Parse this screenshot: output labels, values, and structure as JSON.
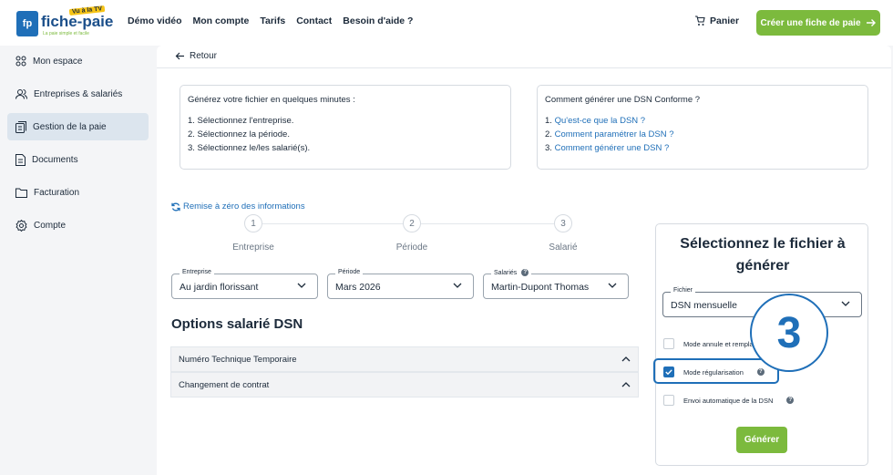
{
  "logo": {
    "initials": "fp",
    "brand": "fiche-paie",
    "badge": "Vu à la TV",
    "tagline": "La paie simple et facile"
  },
  "nav": [
    "Démo vidéo",
    "Mon compte",
    "Tarifs",
    "Contact",
    "Besoin d'aide ?"
  ],
  "cart_label": "Panier",
  "cta_label": "Créer une fiche de paie",
  "sidebar": [
    {
      "label": "Mon espace",
      "icon": "grid-icon"
    },
    {
      "label": "Entreprises & salariés",
      "icon": "users-icon"
    },
    {
      "label": "Gestion de la paie",
      "icon": "payroll-icon",
      "active": true
    },
    {
      "label": "Documents",
      "icon": "document-icon"
    },
    {
      "label": "Facturation",
      "icon": "folder-icon"
    },
    {
      "label": "Compte",
      "icon": "gear-icon"
    }
  ],
  "back_label": "Retour",
  "intro_card": {
    "heading": "Générez votre fichier en quelques minutes :",
    "items": [
      "1. Sélectionnez l'entreprise.",
      "2. Sélectionnez la période.",
      "3. Sélectionnez le/les salarié(s)."
    ]
  },
  "help_card": {
    "heading": "Comment générer une DSN Conforme ?",
    "items": [
      {
        "num": "1.",
        "link": "Qu'est-ce que la DSN ?"
      },
      {
        "num": "2.",
        "link": "Comment paramétrer la DSN ?"
      },
      {
        "num": "3.",
        "link": "Comment générer une DSN ?"
      }
    ]
  },
  "reset_label": "Remise à zéro des informations",
  "steps": [
    {
      "num": "1",
      "label": "Entreprise"
    },
    {
      "num": "2",
      "label": "Période"
    },
    {
      "num": "3",
      "label": "Salarié"
    }
  ],
  "selects": {
    "entreprise": {
      "label": "Entreprise",
      "value": "Au jardin florissant"
    },
    "periode": {
      "label": "Période",
      "value": "Mars 2026"
    },
    "salaries": {
      "label": "Salariés",
      "value": "Martin-Dupont Thomas"
    }
  },
  "options_title": "Options salarié DSN",
  "accordions": [
    "Numéro Technique Temporaire",
    "Changement de contrat"
  ],
  "panel": {
    "title": "Sélectionnez le fichier à générer",
    "fichier_label": "Fichier",
    "fichier_value": "DSN mensuelle",
    "checks": [
      {
        "label": "Mode annule et remplace",
        "checked": false
      },
      {
        "label": "Mode régularisation",
        "checked": true
      },
      {
        "label": "Envoi automatique de la DSN",
        "checked": false
      }
    ],
    "generate_label": "Générer"
  },
  "step_badge": "3",
  "colors": {
    "accent": "#1f6fb8",
    "brand_green": "#7cba3d",
    "navy": "#1c2a3a"
  }
}
